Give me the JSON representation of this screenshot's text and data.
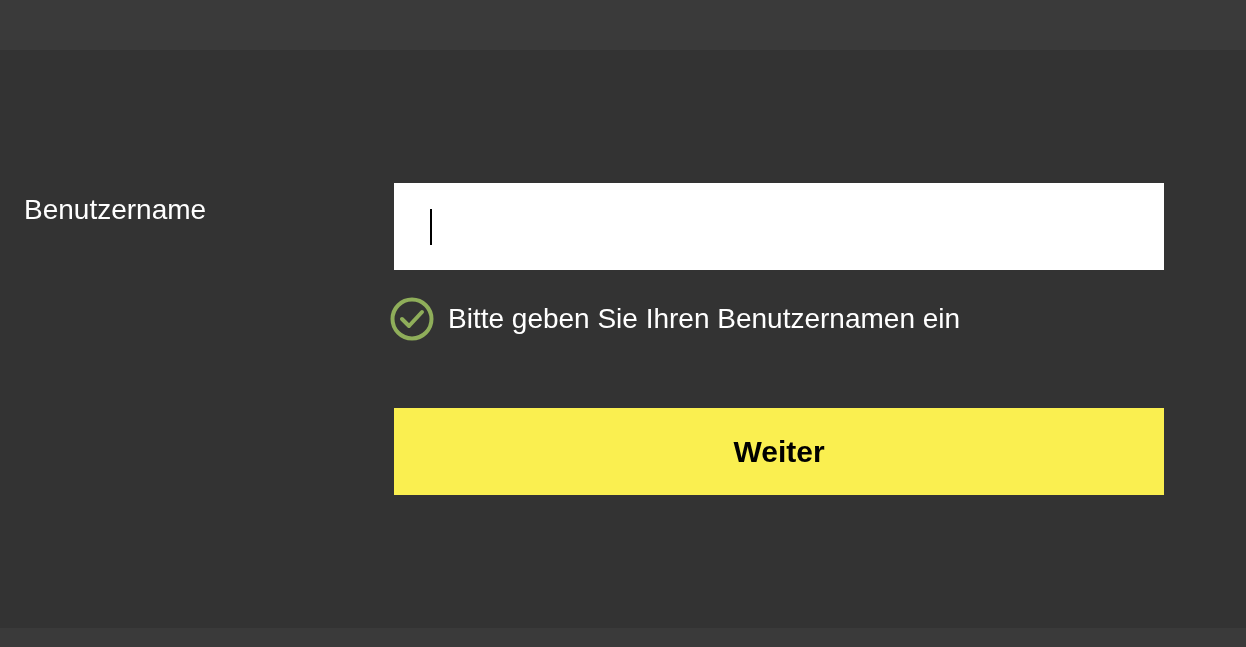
{
  "field": {
    "label": "Benutzername",
    "focused": true
  },
  "hint": {
    "text": "Bitte geben Sie Ihren Benutzernamen ein",
    "valid": true
  },
  "button": {
    "label": "Weiter"
  }
}
